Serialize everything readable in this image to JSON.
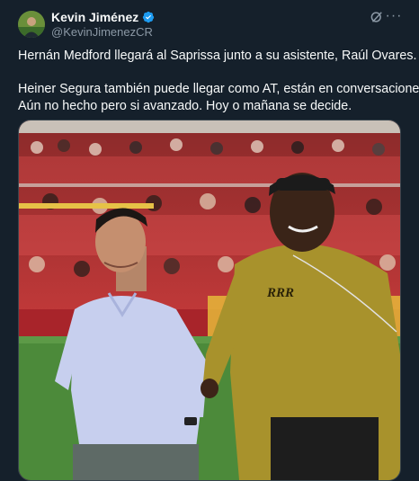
{
  "author": {
    "display_name": "Kevin Jiménez",
    "handle": "@KevinJimenezCR",
    "verified": true,
    "avatar_icon": "profile-avatar"
  },
  "actions": {
    "grok_icon": "grok-icon",
    "more_icon": "more-options-icon",
    "more_glyph": "···"
  },
  "tweet": {
    "line1": "Hernán Medford llegará al Saprissa junto a su asistente, Raúl Ovares.",
    "line2": "Heiner Segura también puede llegar como AT, están en conversaciones.",
    "line3": "Aún no hecho pero si avanzado. Hoy o mañana se decide."
  },
  "media": {
    "description_icon": "photo-two-men-walking-on-football-pitch",
    "sweater_text": "RRR"
  },
  "colors": {
    "background": "#15202b",
    "text": "#f7f9f9",
    "secondary": "#8b98a5",
    "verified": "#1d9bf0"
  }
}
